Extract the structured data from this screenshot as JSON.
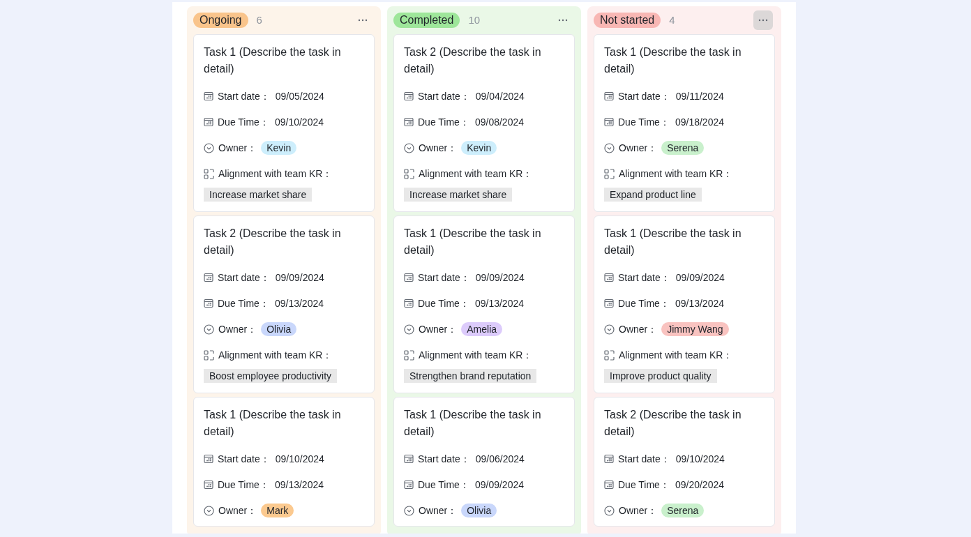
{
  "columns": [
    {
      "status": "Ongoing",
      "count": "6",
      "color": "#f9c48b",
      "menu_active": false,
      "cards": [
        {
          "title": "Task 1 (Describe the task in detail)",
          "start_label": "Start date：",
          "start": "09/05/2024",
          "due_label": "Due Time：",
          "due": "09/10/2024",
          "owner_label": "Owner：",
          "owner": {
            "name": "Kevin",
            "color": "#cdeefc"
          },
          "kr_label": "Alignment with team KR：",
          "kr": "Increase market share"
        },
        {
          "title": "Task 2 (Describe the task in detail)",
          "start_label": "Start date：",
          "start": "09/09/2024",
          "due_label": "Due Time：",
          "due": "09/13/2024",
          "owner_label": "Owner：",
          "owner": {
            "name": "Olivia",
            "color": "#c9d7fb"
          },
          "kr_label": "Alignment with team KR：",
          "kr": "Boost employee productivity"
        },
        {
          "title": "Task 1 (Describe the task in detail)",
          "start_label": "Start date：",
          "start": "09/10/2024",
          "due_label": "Due Time：",
          "due": "09/13/2024",
          "owner_label": "Owner：",
          "owner": {
            "name": "Mark",
            "color": "#fbc98f"
          }
        }
      ]
    },
    {
      "status": "Completed",
      "count": "10",
      "color": "#9ee69a",
      "menu_active": false,
      "cards": [
        {
          "title": "Task 2 (Describe the task in detail)",
          "start_label": "Start date：",
          "start": "09/04/2024",
          "due_label": "Due Time：",
          "due": "09/08/2024",
          "owner_label": "Owner：",
          "owner": {
            "name": "Kevin",
            "color": "#cdeefc"
          },
          "kr_label": "Alignment with team KR：",
          "kr": "Increase market share"
        },
        {
          "title": "Task 1 (Describe the task in detail)",
          "start_label": "Start date：",
          "start": "09/09/2024",
          "due_label": "Due Time：",
          "due": "09/13/2024",
          "owner_label": "Owner：",
          "owner": {
            "name": "Amelia",
            "color": "#dccbfb"
          },
          "kr_label": "Alignment with team KR：",
          "kr": "Strengthen brand reputation"
        },
        {
          "title": "Task 1 (Describe the task in detail)",
          "start_label": "Start date：",
          "start": "09/06/2024",
          "due_label": "Due Time：",
          "due": "09/09/2024",
          "owner_label": "Owner：",
          "owner": {
            "name": "Olivia",
            "color": "#c9d7fb"
          }
        }
      ]
    },
    {
      "status": "Not started",
      "count": "4",
      "color": "#f8b7b4",
      "menu_active": true,
      "cards": [
        {
          "title": "Task 1 (Describe the task in detail)",
          "start_label": "Start date：",
          "start": "09/11/2024",
          "due_label": "Due Time：",
          "due": "09/18/2024",
          "owner_label": "Owner：",
          "owner": {
            "name": "Serena",
            "color": "#c9f0cc"
          },
          "kr_label": "Alignment with team KR：",
          "kr": "Expand product line"
        },
        {
          "title": "Task 1 (Describe the task in detail)",
          "start_label": "Start date：",
          "start": "09/09/2024",
          "due_label": "Due Time：",
          "due": "09/13/2024",
          "owner_label": "Owner：",
          "owner": {
            "name": "Jimmy Wang",
            "color": "#f9c3c0"
          },
          "kr_label": "Alignment with team KR：",
          "kr": "Improve product quality"
        },
        {
          "title": "Task 2 (Describe the task in detail)",
          "start_label": "Start date：",
          "start": "09/10/2024",
          "due_label": "Due Time：",
          "due": "09/20/2024",
          "owner_label": "Owner：",
          "owner": {
            "name": "Serena",
            "color": "#c9f0cc"
          }
        }
      ]
    }
  ]
}
